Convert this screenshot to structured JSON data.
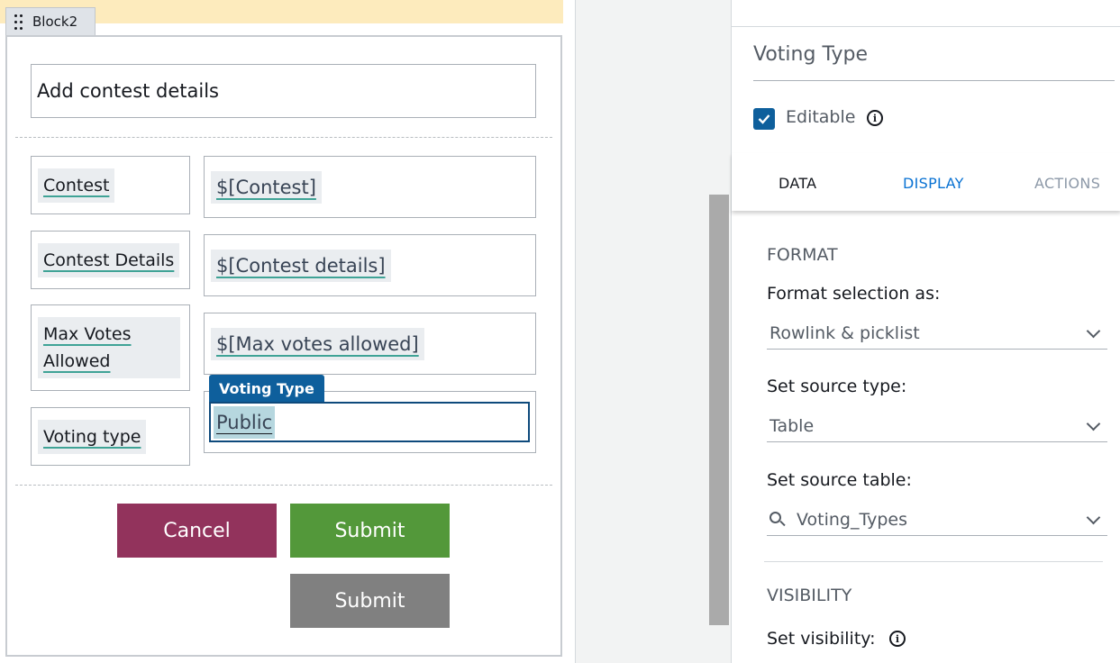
{
  "canvas": {
    "block_tab_label": "Block2",
    "heading": "Add contest details",
    "rows": [
      {
        "label": "Contest",
        "value": "$[Contest]"
      },
      {
        "label": "Contest Details",
        "value": "$[Contest details]"
      },
      {
        "label_line1": "Max Votes",
        "label_line2": "Allowed",
        "value": "$[Max votes allowed]"
      },
      {
        "label": "Voting type",
        "tag": "Voting Type",
        "value": "Public"
      }
    ],
    "buttons": {
      "cancel": "Cancel",
      "submit": "Submit",
      "submit_secondary": "Submit"
    }
  },
  "panel": {
    "title": "Voting Type",
    "editable_label": "Editable",
    "editable_checked": true,
    "tabs": {
      "data": "DATA",
      "display": "DISPLAY",
      "actions": "ACTIONS",
      "active": "DISPLAY"
    },
    "format": {
      "heading": "FORMAT",
      "format_selection_label": "Format selection as:",
      "format_selection_value": "Rowlink & picklist",
      "source_type_label": "Set source type:",
      "source_type_value": "Table",
      "source_table_label": "Set source table:",
      "source_table_value": "Voting_Types"
    },
    "visibility": {
      "heading": "VISIBILITY",
      "set_visibility_label": "Set visibility:"
    }
  },
  "colors": {
    "accent_blue": "#0972d3",
    "checkbox_blue": "#0e5f9c",
    "cancel_button": "#92335c",
    "submit_button": "#53983a",
    "submit_secondary_button": "#808080",
    "banner_yellow": "#fdebbd"
  },
  "icons": [
    "drag-handle-icon",
    "check-icon",
    "info-icon",
    "chevron-down-icon",
    "search-icon"
  ]
}
